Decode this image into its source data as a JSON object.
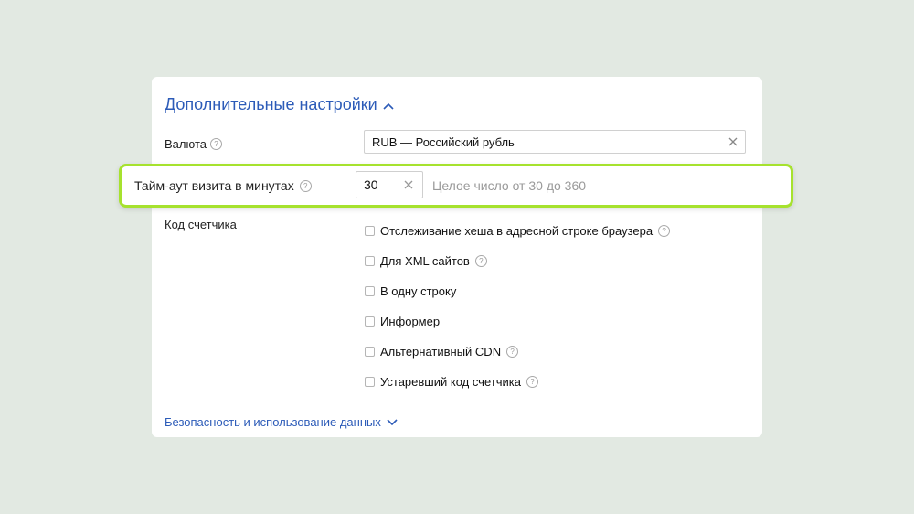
{
  "section": {
    "title": "Дополнительные настройки"
  },
  "currency": {
    "label": "Валюта",
    "value": "RUB — Российский рубль"
  },
  "timeout": {
    "label": "Тайм-аут визита в минутах",
    "value": "30",
    "hint": "Целое число от 30 до 360"
  },
  "counter_code": {
    "label": "Код счетчика",
    "options": [
      {
        "label": "Отслеживание хеша в адресной строке браузера",
        "checked": false,
        "help": true
      },
      {
        "label": "Для XML сайтов",
        "checked": false,
        "help": true
      },
      {
        "label": "В одну строку",
        "checked": false,
        "help": false
      },
      {
        "label": "Информер",
        "checked": false,
        "help": false
      },
      {
        "label": "Альтернативный CDN",
        "checked": false,
        "help": true
      },
      {
        "label": "Устаревший код счетчика",
        "checked": false,
        "help": true
      }
    ]
  },
  "footer": {
    "link": "Безопасность и использование данных"
  },
  "colors": {
    "accent": "#2c5bb8",
    "highlight": "#a6e22e",
    "background": "#e2e9e2"
  },
  "help_glyph": "?"
}
